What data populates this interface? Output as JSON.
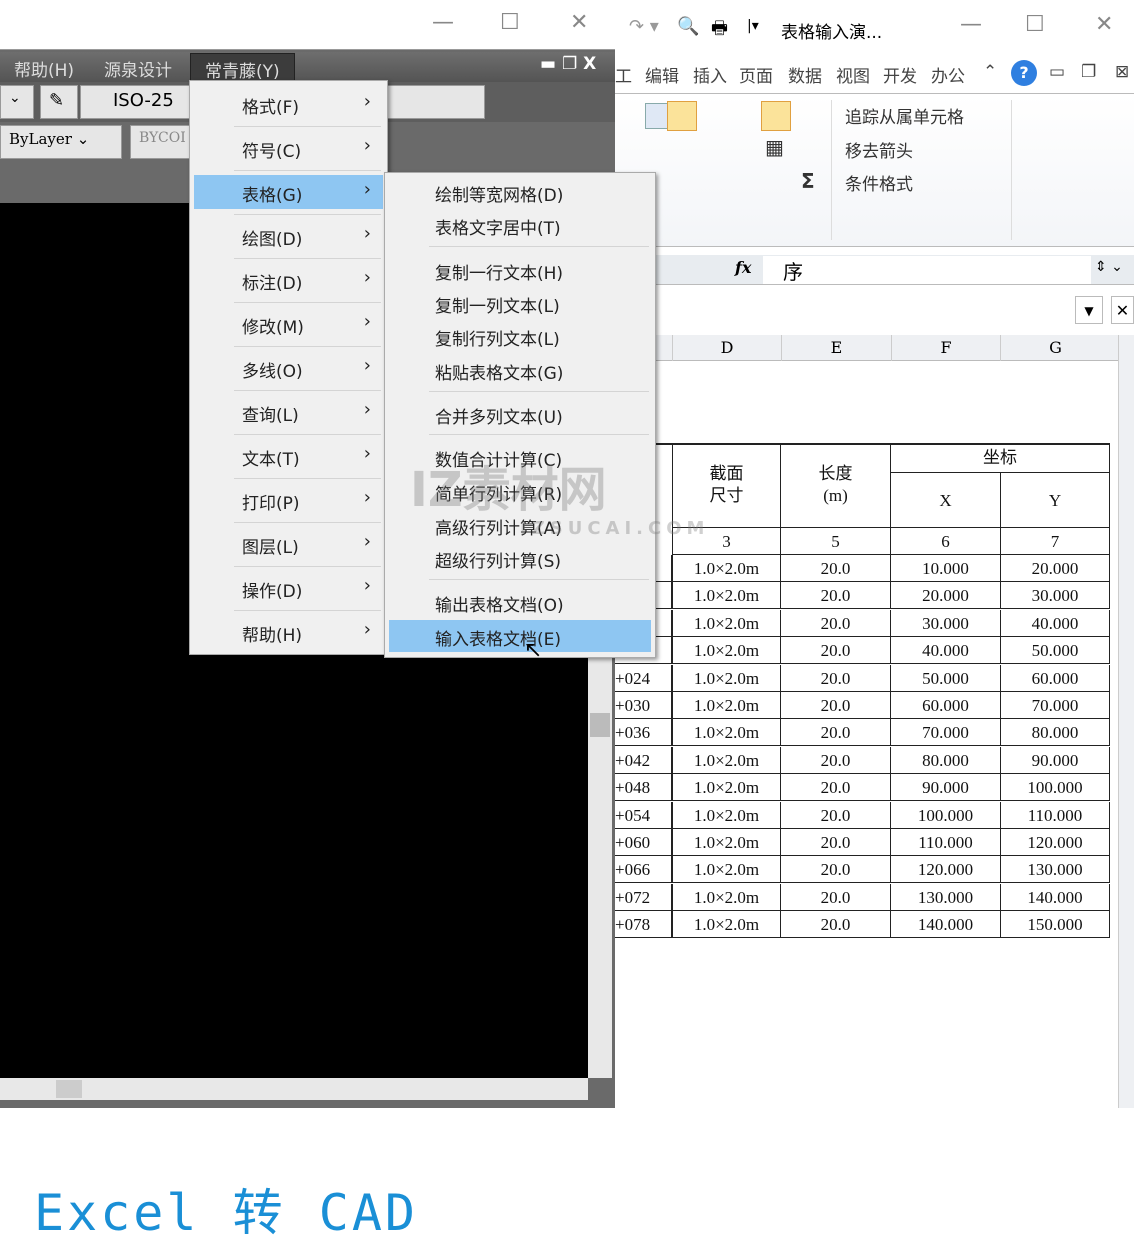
{
  "cad": {
    "menubar": [
      "帮助(H)",
      "源泉设计",
      "常青藤(Y)"
    ],
    "dimstyle": "ISO-25",
    "linetype": "ByLayer",
    "color": "BYCOI",
    "canvas_text": "Excel 转 CAD",
    "menu": [
      "格式(F)",
      "符号(C)",
      "表格(G)",
      "绘图(D)",
      "标注(D)",
      "修改(M)",
      "多线(O)",
      "查询(L)",
      "文本(T)",
      "打印(P)",
      "图层(L)",
      "操作(D)",
      "帮助(H)"
    ],
    "menu_selected": "表格(G)",
    "submenu": [
      "绘制等宽网格(D)",
      "表格文字居中(T)",
      "复制一行文本(H)",
      "复制一列文本(L)",
      "复制行列文本(L)",
      "粘贴表格文本(G)",
      "合并多列文本(U)",
      "数值合计计算(C)",
      "简单行列计算(R)",
      "高级行列计算(A)",
      "超级行列计算(S)",
      "输出表格文档(O)",
      "输入表格文档(E)"
    ],
    "submenu_selected": "输入表格文档(E)"
  },
  "excel": {
    "title": "表格输入演...",
    "tabs": [
      "工",
      "编辑",
      "插入",
      "页面",
      "数据",
      "视图",
      "开发",
      "办公"
    ],
    "ribbon": {
      "trace": "追踪从属单元格",
      "remove_arrows": "移去箭头",
      "cond_format": "条件格式",
      "sigma": "Σ"
    },
    "fx": "fx",
    "formula": "序",
    "columns": [
      "D",
      "E",
      "F",
      "G"
    ],
    "header": {
      "section": "截面\n尺寸",
      "length": "长度\n(m)",
      "coord": "坐标",
      "x": "X",
      "y": "Y"
    },
    "index_row": [
      "3",
      "5",
      "6",
      "7"
    ],
    "rows": [
      [
        "",
        "1.0×2.0m",
        "20.0",
        "10.000",
        "20.000"
      ],
      [
        "",
        "1.0×2.0m",
        "20.0",
        "20.000",
        "30.000"
      ],
      [
        "",
        "1.0×2.0m",
        "20.0",
        "30.000",
        "40.000"
      ],
      [
        "",
        "1.0×2.0m",
        "20.0",
        "40.000",
        "50.000"
      ],
      [
        "+024",
        "1.0×2.0m",
        "20.0",
        "50.000",
        "60.000"
      ],
      [
        "+030",
        "1.0×2.0m",
        "20.0",
        "60.000",
        "70.000"
      ],
      [
        "+036",
        "1.0×2.0m",
        "20.0",
        "70.000",
        "80.000"
      ],
      [
        "+042",
        "1.0×2.0m",
        "20.0",
        "80.000",
        "90.000"
      ],
      [
        "+048",
        "1.0×2.0m",
        "20.0",
        "90.000",
        "100.000"
      ],
      [
        "+054",
        "1.0×2.0m",
        "20.0",
        "100.000",
        "110.000"
      ],
      [
        "+060",
        "1.0×2.0m",
        "20.0",
        "110.000",
        "120.000"
      ],
      [
        "+066",
        "1.0×2.0m",
        "20.0",
        "120.000",
        "130.000"
      ],
      [
        "+072",
        "1.0×2.0m",
        "20.0",
        "130.000",
        "140.000"
      ],
      [
        "+078",
        "1.0×2.0m",
        "20.0",
        "140.000",
        "150.000"
      ]
    ]
  },
  "watermark": "IZ素材网 IZSUCAI.COM",
  "colors": {
    "menu_highlight": "#8ec6f2",
    "cad_text": "#1a8fd6"
  }
}
